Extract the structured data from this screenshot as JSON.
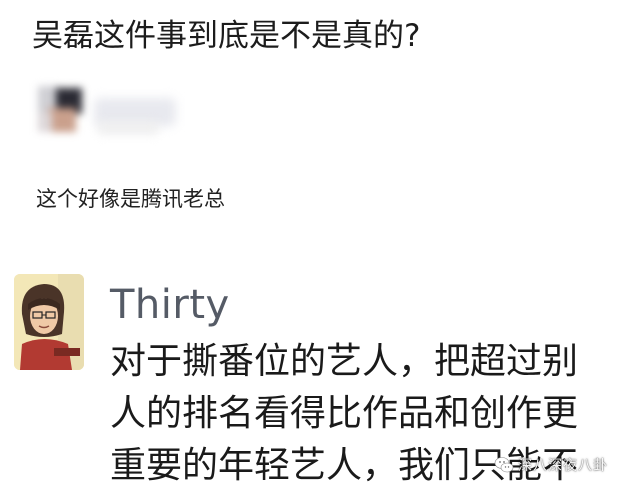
{
  "question": {
    "title": "吴磊这件事到底是不是真的?"
  },
  "comment": {
    "text": "这个好像是腾讯老总"
  },
  "reply": {
    "username": "Thirty",
    "lines": [
      "对于撕番位的艺人，把超过别",
      "人的排名看得比作品和创作更",
      "重要的年轻艺人，我们只能不"
    ]
  },
  "watermark": {
    "icon": "wechat-logo-icon",
    "text": "深八深夜八卦"
  }
}
